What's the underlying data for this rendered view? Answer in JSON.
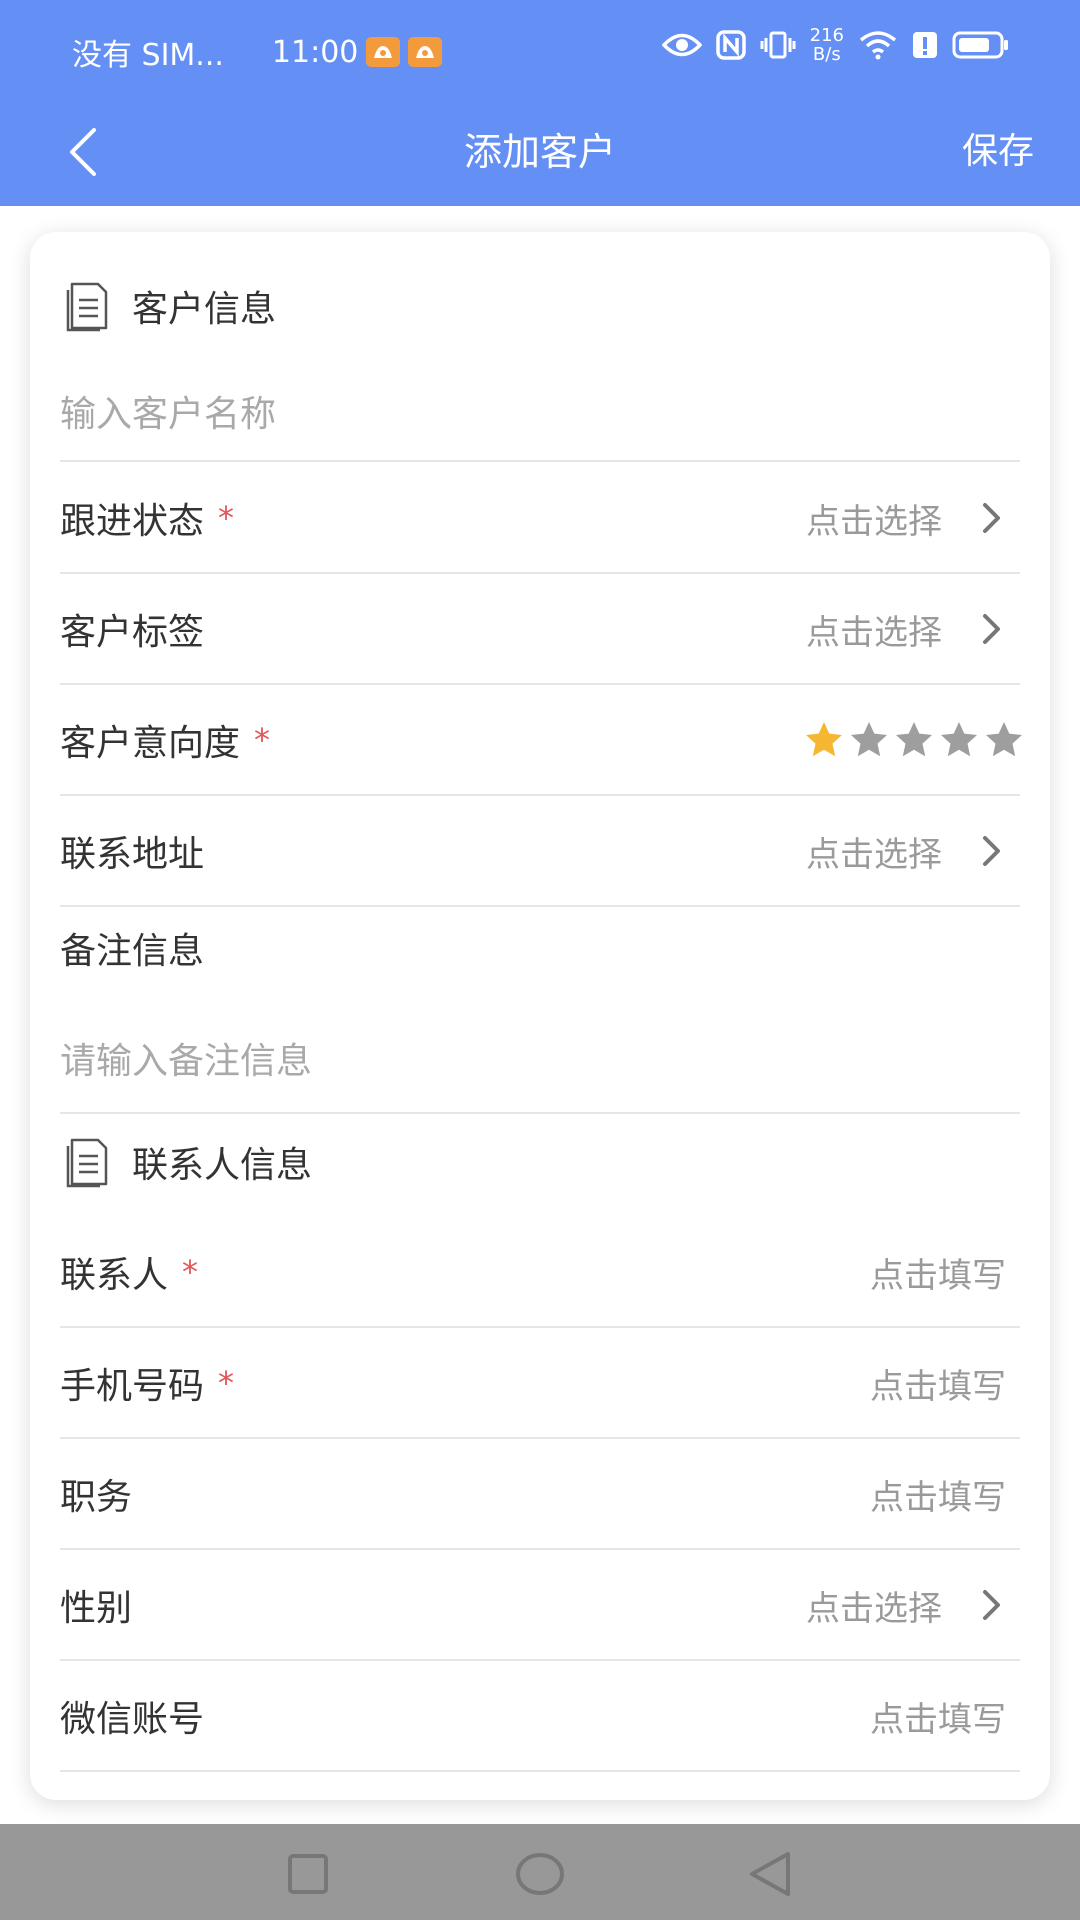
{
  "status_bar": {
    "carrier": "没有 SIM...",
    "time": "11:00",
    "speed_value": "216",
    "speed_unit": "B/s"
  },
  "nav": {
    "title": "添加客户",
    "save_label": "保存"
  },
  "customer_section": {
    "title": "客户信息",
    "name_placeholder": "输入客户名称",
    "rows": [
      {
        "label": "跟进状态",
        "value": "点击选择"
      },
      {
        "label": "客户标签",
        "value": "点击选择"
      },
      {
        "label": "客户意向度"
      },
      {
        "label": "联系地址",
        "value": "点击选择"
      }
    ],
    "intent_rating": 1,
    "intent_max": 5,
    "remark_label": "备注信息",
    "remark_placeholder": "请输入备注信息"
  },
  "contact_section": {
    "title": "联系人信息",
    "rows": [
      {
        "label": "联系人",
        "value": "点击填写"
      },
      {
        "label": "手机号码",
        "value": "点击填写"
      },
      {
        "label": "职务",
        "value": "点击填写"
      },
      {
        "label": "性别",
        "value": "点击选择"
      },
      {
        "label": "微信账号",
        "value": "点击填写"
      }
    ]
  },
  "required_mark": "*",
  "colors": {
    "header": "#648ff4",
    "star_active": "#f5b731",
    "star_inactive": "#9e9e9e",
    "required": "#e0565a"
  },
  "icons": [
    "chevron-left-icon",
    "document-icon",
    "chevron-right-icon",
    "star-icon",
    "square-icon",
    "circle-icon",
    "triangle-back-icon"
  ]
}
